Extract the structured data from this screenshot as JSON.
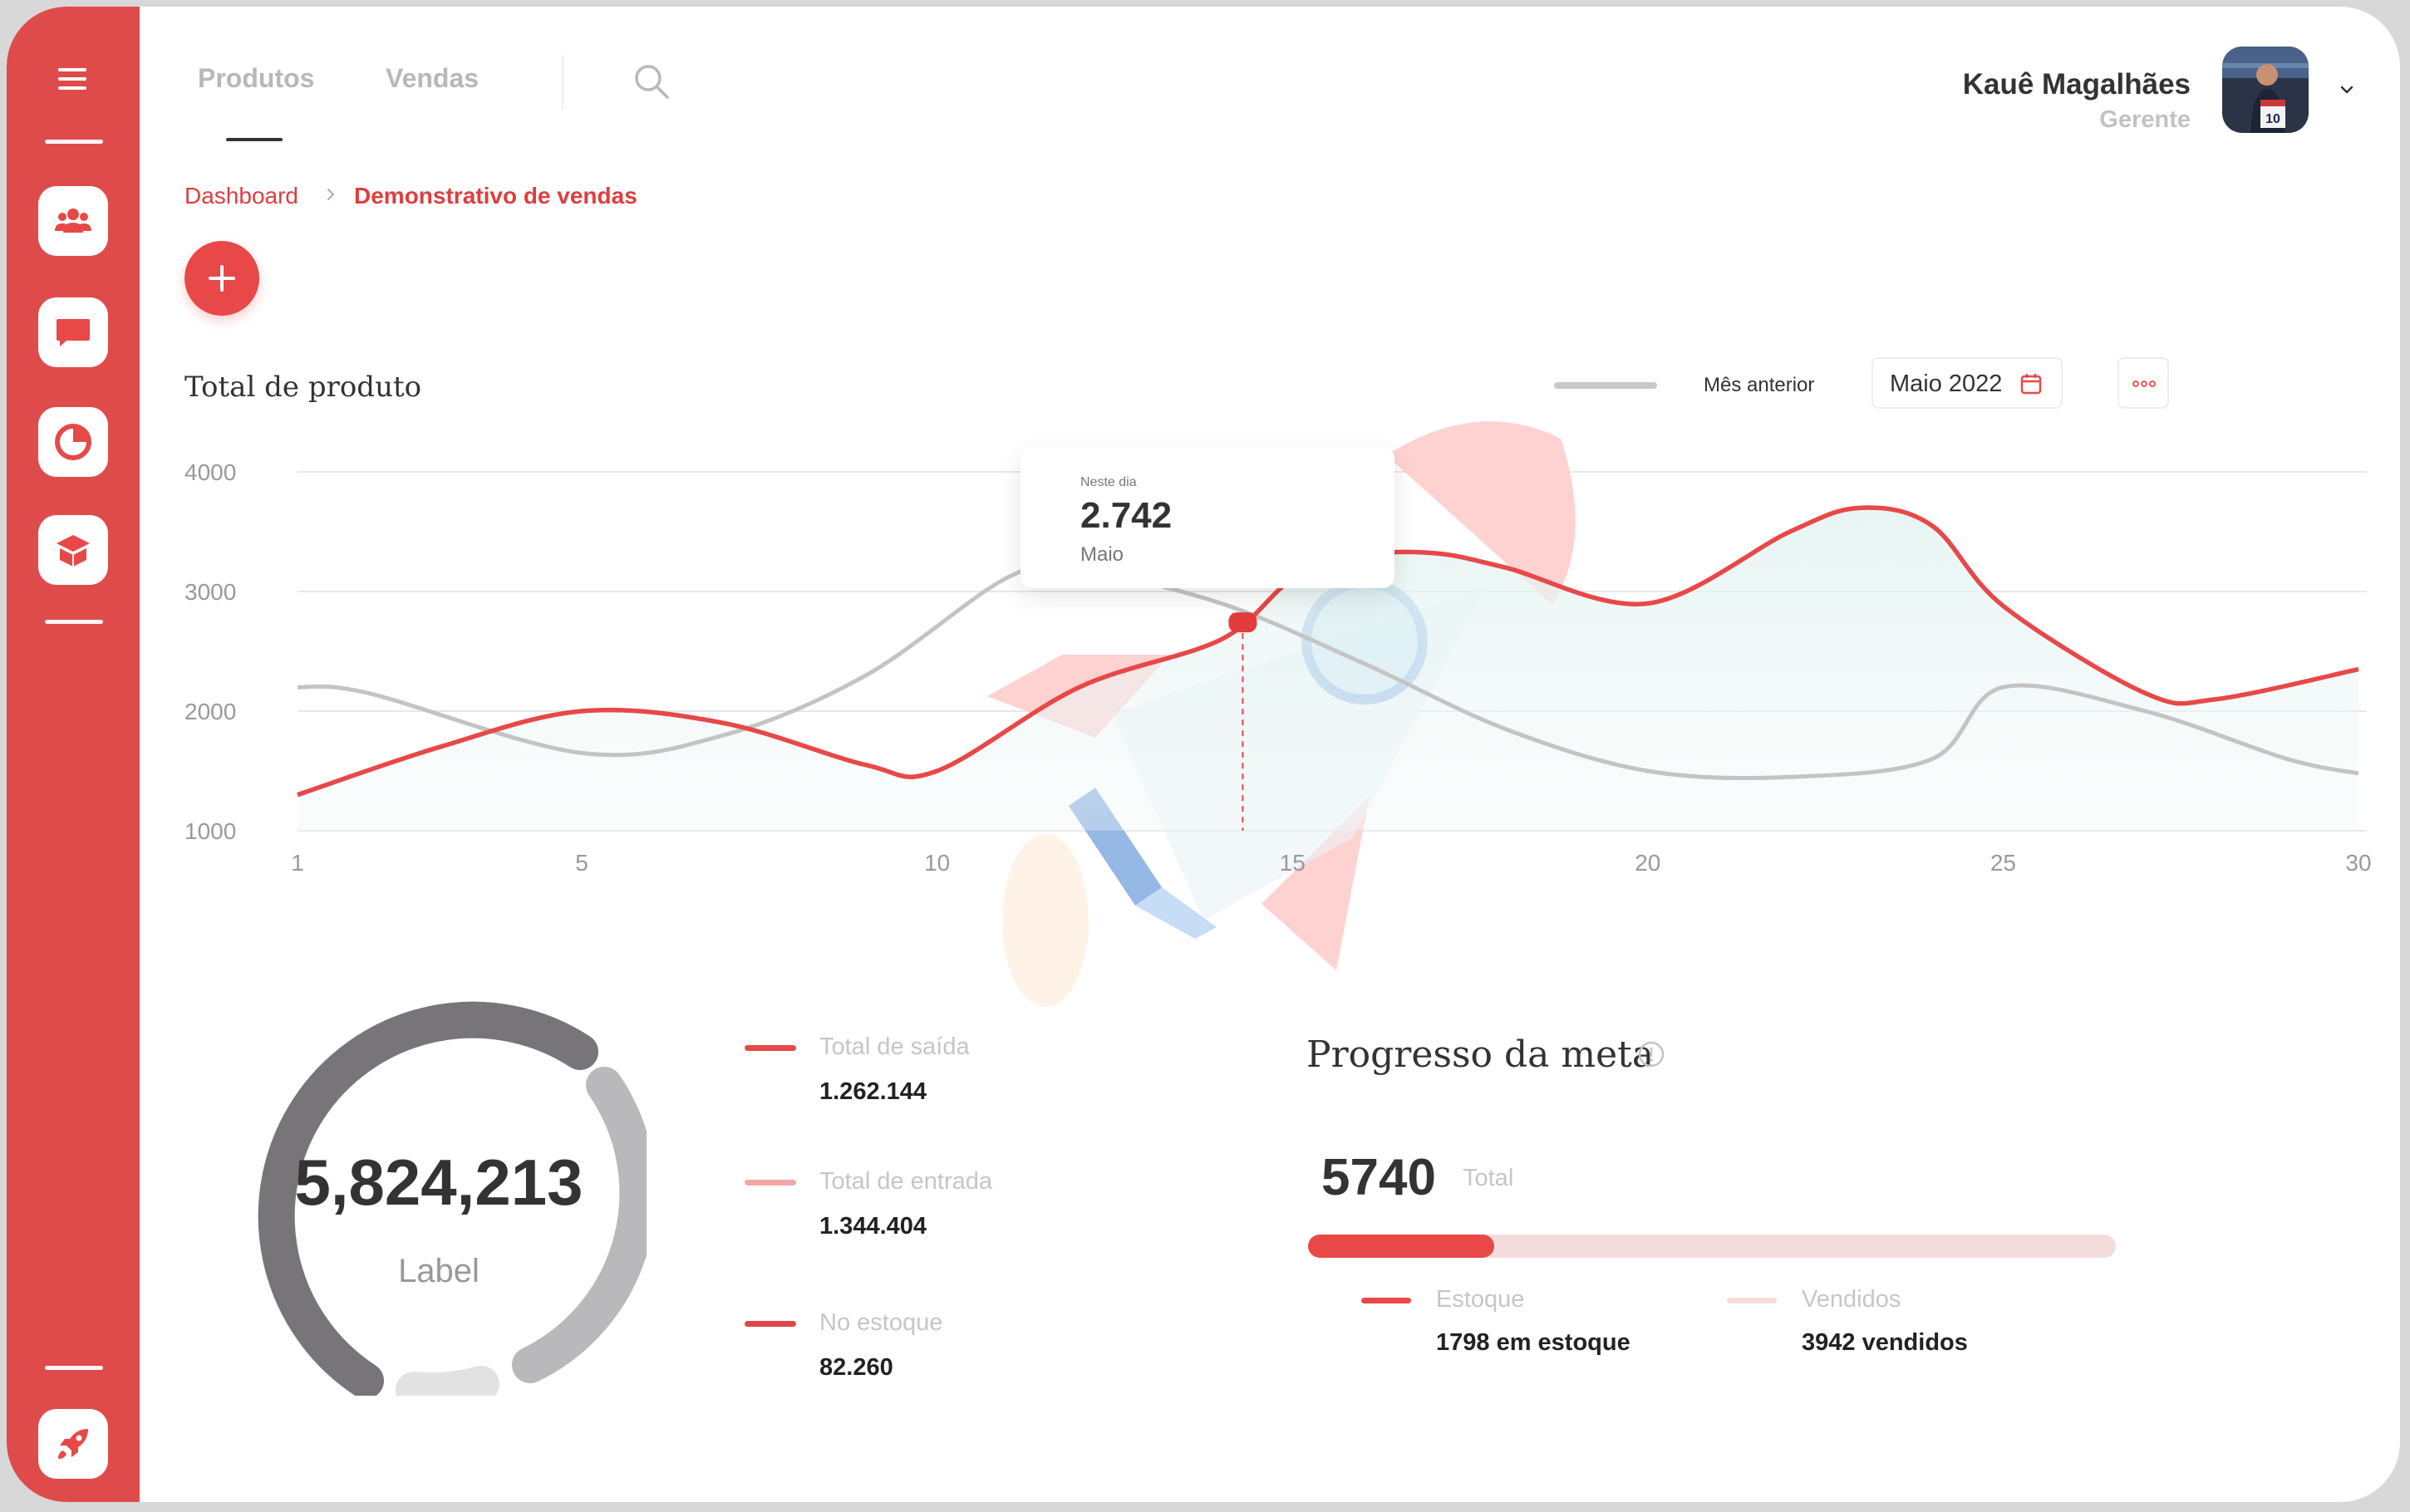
{
  "nav": {
    "tabs": [
      {
        "label": "Produtos"
      },
      {
        "label": "Vendas"
      }
    ],
    "active_tab": "Produtos"
  },
  "user": {
    "name": "Kauê Magalhães",
    "role": "Gerente"
  },
  "sidebar": {
    "items": [
      {
        "icon": "users-icon"
      },
      {
        "icon": "chat-icon"
      },
      {
        "icon": "pie-chart-icon"
      },
      {
        "icon": "box-icon"
      },
      {
        "icon": "rocket-icon"
      }
    ]
  },
  "breadcrumb": {
    "items": [
      "Dashboard",
      "Demonstrativo de vendas"
    ]
  },
  "chart_section": {
    "title": "Total de produto",
    "legend_label": "Mês anterior",
    "date_value": "Maio 2022",
    "tooltip": {
      "label": "Neste dia",
      "value": "2.742",
      "month": "Maio"
    }
  },
  "colors": {
    "accent": "#e84848",
    "sidebar": "#df4b4b",
    "previous": "#c4c4c4",
    "soft_red": "#f5dcdc",
    "donut_dark": "#777579",
    "donut_light": "#b9b8bb"
  },
  "chart_data": {
    "type": "line",
    "ylim": [
      1000,
      4000
    ],
    "yticks": [
      4000,
      3000,
      2000,
      1000
    ],
    "xlim": [
      1,
      30
    ],
    "xticks": [
      1,
      5,
      10,
      15,
      20,
      25,
      30
    ],
    "highlight": {
      "x": 14.3,
      "y": 2742
    },
    "series": [
      {
        "name": "Mês anterior",
        "color": "#c4c4c4",
        "x": [
          1,
          2,
          5,
          7,
          9,
          11,
          12,
          14,
          16,
          18,
          20,
          22,
          24,
          25,
          27,
          29,
          30
        ],
        "y": [
          2200,
          2150,
          1650,
          1800,
          2300,
          3120,
          3180,
          2900,
          2400,
          1850,
          1500,
          1450,
          1600,
          2200,
          2000,
          1600,
          1480
        ]
      },
      {
        "name": "",
        "color": "#e84848",
        "x": [
          1,
          3,
          5,
          7,
          9,
          10,
          12,
          14,
          15,
          16,
          17,
          18,
          20,
          22,
          23,
          24,
          25,
          27,
          28,
          30
        ],
        "y": [
          1300,
          1700,
          2000,
          1900,
          1550,
          1500,
          2200,
          2600,
          3100,
          3300,
          3320,
          3200,
          2900,
          3500,
          3700,
          3550,
          2880,
          2150,
          2100,
          2350
        ]
      }
    ]
  },
  "donut": {
    "value": "5,824,213",
    "label": "Label"
  },
  "stats": [
    {
      "label": "Total de saída",
      "value": "1.262.144",
      "color": "#e84848"
    },
    {
      "label": "Total de entrada",
      "value": "1.344.404",
      "color": "#f0a8a8"
    },
    {
      "label": "No estoque",
      "value": "82.260",
      "color": "#dc4848"
    }
  ],
  "goal": {
    "title": "Progresso da meta",
    "total": "5740",
    "total_label": "Total",
    "progress": 0.23,
    "legend": [
      {
        "label": "Estoque",
        "value": "1798  em estoque",
        "color": "#e84848"
      },
      {
        "label": "Vendidos",
        "value": "3942 vendidos",
        "color": "#f5dcdc"
      }
    ]
  }
}
